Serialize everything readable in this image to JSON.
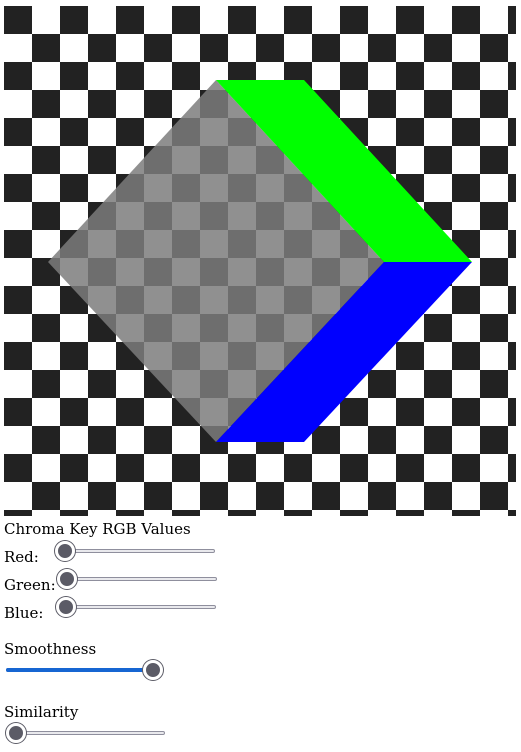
{
  "canvas": {
    "image_name": "chroma-key-preview",
    "colors": {
      "dark_square": "#222222",
      "light_square": "#ffffff",
      "keyed_dark": "#6e6e6e",
      "keyed_light": "#909090",
      "top_face": "#00ff00",
      "bottom_face": "#0000ff"
    }
  },
  "controls": {
    "heading": "Chroma Key RGB Values",
    "red_label": "Red:",
    "green_label": "Green:",
    "blue_label": "Blue:",
    "red_value": 0,
    "green_value": 0,
    "blue_value": 0,
    "smoothness_label": "Smoothness",
    "smoothness_value": 1.0,
    "similarity_label": "Similarity",
    "similarity_value": 0
  }
}
